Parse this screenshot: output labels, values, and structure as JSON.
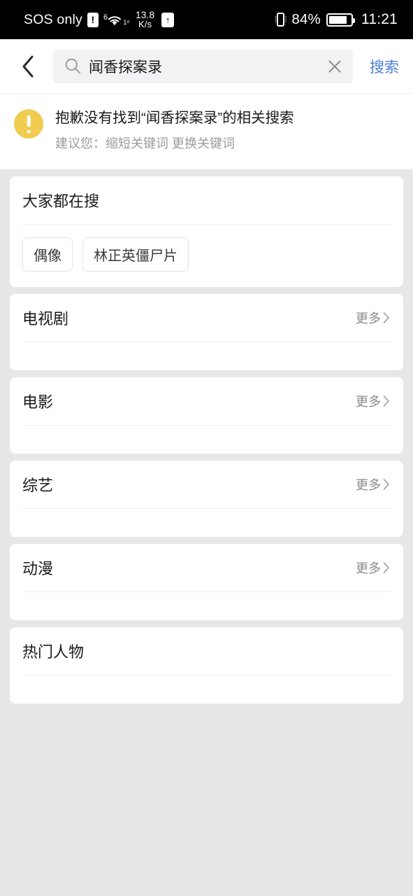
{
  "status_bar": {
    "carrier": "SOS only",
    "alert_badge": "!",
    "wifi_generation": "6",
    "wifi_band": "1ᵈ",
    "net_speed_value": "13.8",
    "net_speed_unit": "K/s",
    "upload_badge": "↑",
    "battery_percent": "84%",
    "battery_level": 84,
    "clock": "11:21",
    "icons": {
      "alert": "alert-icon",
      "wifi": "wifi-icon",
      "upload": "upload-icon",
      "vibrate": "vibrate-icon",
      "battery": "battery-icon"
    }
  },
  "search_bar": {
    "back_icon": "chevron-left-icon",
    "search_icon": "search-icon",
    "query": "闻香探案录",
    "placeholder": "搜索",
    "clear_icon": "close-icon",
    "submit_label": "搜索",
    "accent_color": "#4a7fd4",
    "field_background": "#f2f2f4"
  },
  "notice": {
    "icon": "warning-icon",
    "icon_color": "#f0cc50",
    "title": "抱歉没有找到“闻香探案录”的相关搜索",
    "subtitle": "建议您：缩短关键词 更换关键词"
  },
  "sections": [
    {
      "title": "大家都在搜",
      "has_more": false,
      "more_label": "",
      "tags": [
        "偶像",
        "林正英僵尸片"
      ]
    },
    {
      "title": "电视剧",
      "has_more": true,
      "more_label": "更多",
      "tags": []
    },
    {
      "title": "电影",
      "has_more": true,
      "more_label": "更多",
      "tags": []
    },
    {
      "title": "综艺",
      "has_more": true,
      "more_label": "更多",
      "tags": []
    },
    {
      "title": "动漫",
      "has_more": true,
      "more_label": "更多",
      "tags": []
    },
    {
      "title": "热门人物",
      "has_more": false,
      "more_label": "",
      "tags": []
    }
  ],
  "colors": {
    "page_background": "#e7e7e7",
    "card_background": "#ffffff",
    "divider": "#ededed",
    "muted_text": "#8a8a8a"
  }
}
